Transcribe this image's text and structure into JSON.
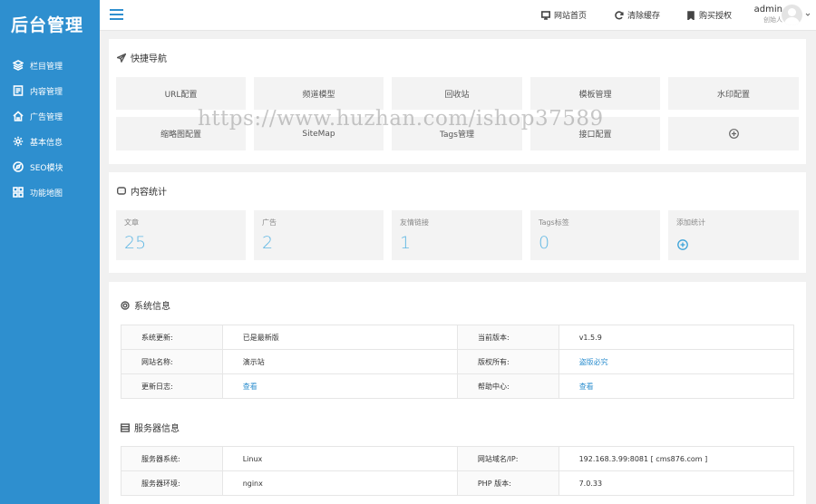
{
  "sidebar": {
    "logo": "后台管理",
    "items": [
      {
        "label": "栏目管理",
        "icon": "layers-icon"
      },
      {
        "label": "内容管理",
        "icon": "document-icon"
      },
      {
        "label": "广告管理",
        "icon": "home-icon"
      },
      {
        "label": "基本信息",
        "icon": "gear-icon"
      },
      {
        "label": "SEO模块",
        "icon": "compass-icon"
      },
      {
        "label": "功能地图",
        "icon": "grid-icon"
      }
    ]
  },
  "header": {
    "links": [
      {
        "label": "网站首页",
        "icon": "monitor-icon"
      },
      {
        "label": "清除缓存",
        "icon": "refresh-icon"
      },
      {
        "label": "购买授权",
        "icon": "bookmark-icon"
      }
    ],
    "user": {
      "name": "admin",
      "role": "创始人"
    }
  },
  "quick_nav": {
    "title": "快捷导航",
    "tiles": [
      "URL配置",
      "频道模型",
      "回收站",
      "模板管理",
      "水印配置",
      "缩略图配置",
      "SiteMap",
      "Tags管理",
      "接口配置"
    ]
  },
  "content_stats": {
    "title": "内容统计",
    "stats": [
      {
        "label": "文章",
        "value": "25"
      },
      {
        "label": "广告",
        "value": "2"
      },
      {
        "label": "友情链接",
        "value": "1"
      },
      {
        "label": "Tags标签",
        "value": "0"
      }
    ],
    "add_label": "添加统计"
  },
  "system_info": {
    "title": "系统信息",
    "rows": [
      {
        "k1": "系统更新:",
        "v1": "已是最新版",
        "k2": "当前版本:",
        "v2": "v1.5.9"
      },
      {
        "k1": "网站名称:",
        "v1": "演示站",
        "k2": "版权所有:",
        "v2": "盗版必究"
      },
      {
        "k1": "更新日志:",
        "v1": "查看",
        "k2": "帮助中心:",
        "v2": "查看"
      }
    ]
  },
  "server_info": {
    "title": "服务器信息",
    "rows": [
      {
        "k1": "服务器系统:",
        "v1": "Linux",
        "k2": "网站域名/IP:",
        "v2": "192.168.3.99:8081 [ cms876.com ]"
      },
      {
        "k1": "服务器环境:",
        "v1": "nginx",
        "k2": "PHP 版本:",
        "v2": "7.0.33"
      }
    ]
  },
  "watermark": "https://www.huzhan.com/ishop37589",
  "colors": {
    "sidebar": "#2e8fcf",
    "accent": "#62b8e4",
    "link": "#2e8fcf"
  }
}
